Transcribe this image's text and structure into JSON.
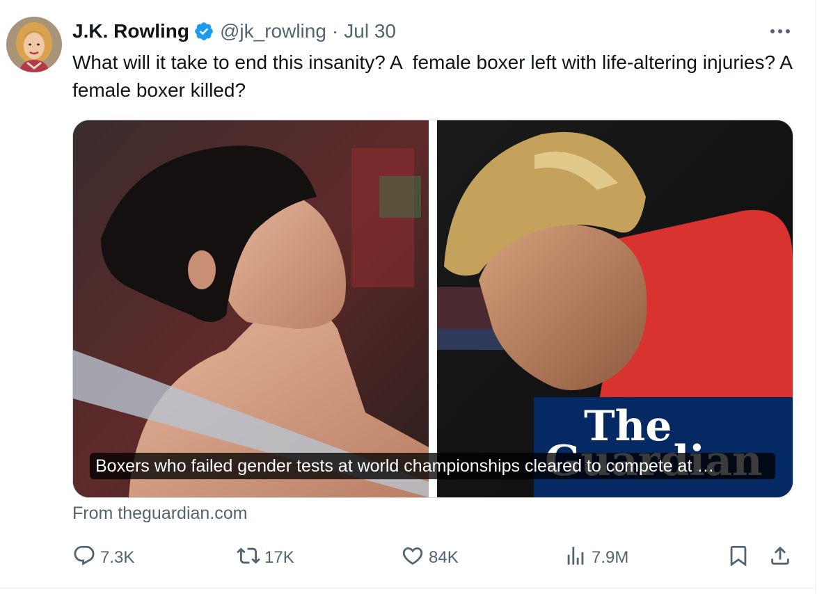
{
  "tweet": {
    "author_name": "J.K. Rowling",
    "handle": "@jk_rowling",
    "separator": "·",
    "date": "Jul 30",
    "text": "What will it take to end this insanity? A  female boxer left with life-altering injuries? A female boxer killed?"
  },
  "card": {
    "caption": "Boxers who failed gender tests at world championships cleared to compete at …",
    "logo_text": "The Guardian",
    "source": "From theguardian.com"
  },
  "actions": {
    "replies": "7.3K",
    "reposts": "17K",
    "likes": "84K",
    "views": "7.9M"
  },
  "colors": {
    "verified": "#1d9bf0",
    "secondary_text": "#536471",
    "guardian_blue": "#052962"
  },
  "icons": [
    "verified-badge-icon",
    "more-icon",
    "reply-icon",
    "repost-icon",
    "like-icon",
    "views-icon",
    "bookmark-icon",
    "share-icon"
  ]
}
